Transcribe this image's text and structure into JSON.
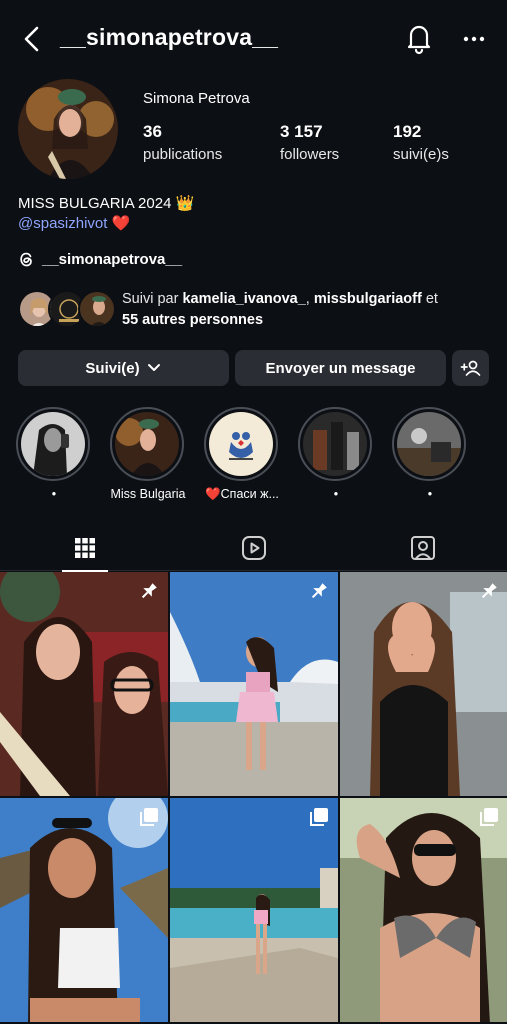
{
  "header": {
    "username": "__simonapetrova__",
    "back_icon": "chevron-left-icon",
    "bell_icon": "bell-icon",
    "more_icon": "more-horizontal-icon"
  },
  "profile": {
    "name": "Simona Petrova",
    "stats": [
      {
        "value": "36",
        "label": "publications"
      },
      {
        "value": "3 157",
        "label": "followers"
      },
      {
        "value": "192",
        "label": "suivi(e)s"
      }
    ],
    "bio_line1": "MISS BULGARIA 2024 👑",
    "bio_mention": "@spasizhivot ❤️",
    "threads_handle": "__simonapetrova__"
  },
  "followed_by": {
    "prefix": "Suivi par ",
    "user1": "kamelia_ivanova_",
    "sep": ", ",
    "user2": "missbulgariaoff",
    "mid": " et ",
    "others": "55 autres personnes"
  },
  "actions": {
    "following_label": "Suivi(e)",
    "message_label": "Envoyer un message"
  },
  "highlights": [
    {
      "label": "•"
    },
    {
      "label": "Miss Bulgaria"
    },
    {
      "label": "❤️Спаси ж..."
    },
    {
      "label": "•"
    },
    {
      "label": "•"
    }
  ],
  "tabs": [
    "grid-icon",
    "reels-icon",
    "tagged-icon"
  ],
  "colors": {
    "background": "#0c0f14",
    "button": "#2a2d33",
    "mention": "#8fa5ff"
  }
}
